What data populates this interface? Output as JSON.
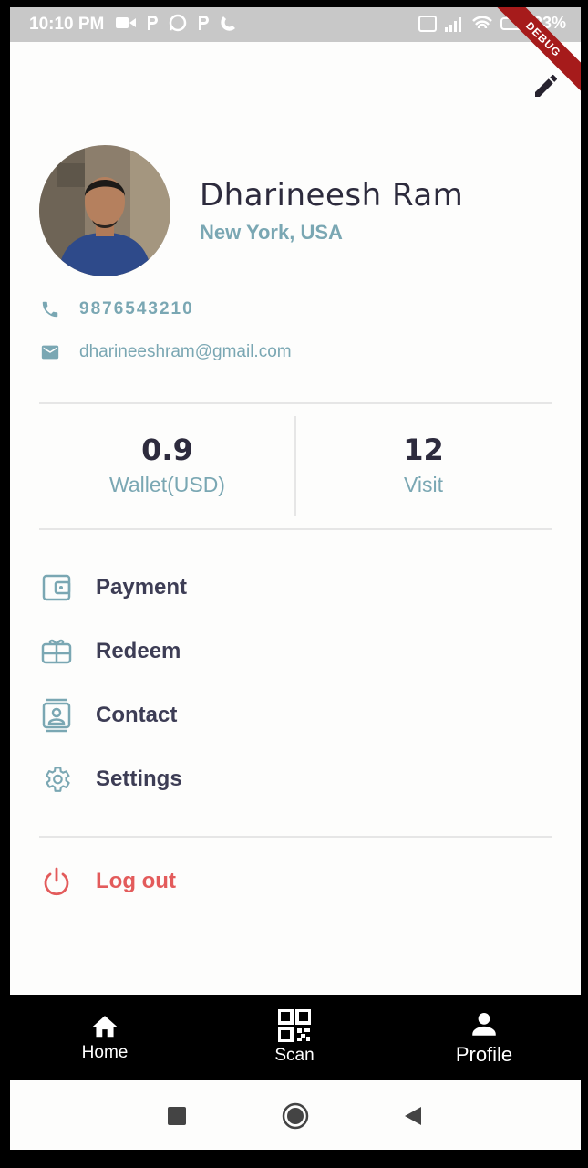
{
  "status_bar": {
    "time": "10:10 PM",
    "battery": "23%",
    "debug_label": "DEBUG"
  },
  "profile": {
    "name": "Dharineesh Ram",
    "location": "New York, USA",
    "phone": "9876543210",
    "email": "dharineeshram@gmail.com"
  },
  "stats": [
    {
      "value": "0.9",
      "label": "Wallet(USD)"
    },
    {
      "value": "12",
      "label": "Visit"
    }
  ],
  "menu": [
    {
      "label": "Payment",
      "icon": "wallet-icon"
    },
    {
      "label": "Redeem",
      "icon": "gift-card-icon"
    },
    {
      "label": "Contact",
      "icon": "contact-card-icon"
    },
    {
      "label": "Settings",
      "icon": "gear-icon"
    }
  ],
  "logout": {
    "label": "Log out",
    "icon": "power-icon"
  },
  "bottom_nav": [
    {
      "label": "Home",
      "icon": "home-icon"
    },
    {
      "label": "Scan",
      "icon": "qr-code-icon"
    },
    {
      "label": "Profile",
      "icon": "person-icon"
    }
  ],
  "colors": {
    "accent": "#7aa7b3",
    "text_dark": "#2d2b3d",
    "logout": "#e35b5b",
    "nav_bg": "#000000"
  }
}
